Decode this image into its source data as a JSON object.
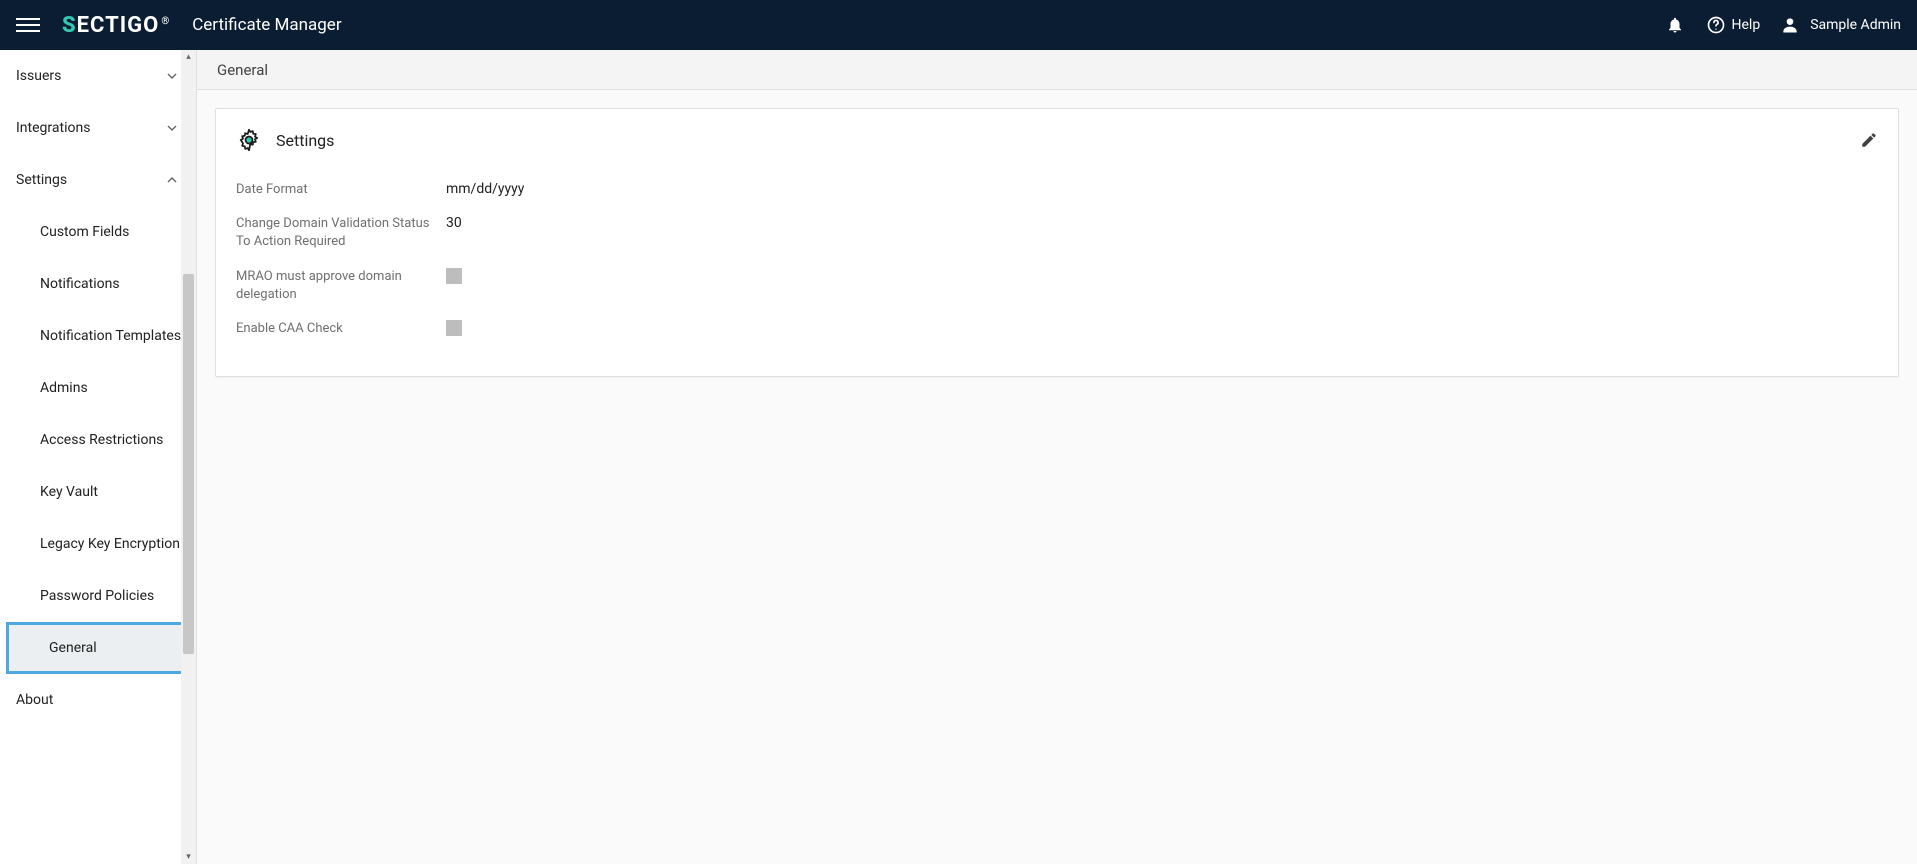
{
  "header": {
    "app_title": "Certificate Manager",
    "logo_s": "S",
    "logo_rest": "ECTIGO",
    "logo_reg": "®",
    "help_label": "Help",
    "user_name": "Sample Admin"
  },
  "sidebar": {
    "issuers": "Issuers",
    "integrations": "Integrations",
    "settings": "Settings",
    "sub": {
      "custom_fields": "Custom Fields",
      "notifications": "Notifications",
      "notification_templates": "Notification Templates",
      "admins": "Admins",
      "access_restrictions": "Access Restrictions",
      "key_vault": "Key Vault",
      "legacy_key_encryption": "Legacy Key Encryption",
      "password_policies": "Password Policies",
      "general": "General"
    },
    "about": "About"
  },
  "page": {
    "title": "General"
  },
  "card": {
    "title": "Settings",
    "rows": {
      "date_format_label": "Date Format",
      "date_format_value": "mm/dd/yyyy",
      "change_status_label": "Change Domain Validation Status To Action Required",
      "change_status_value": "30",
      "mrao_label": "MRAO must approve domain delegation",
      "caa_label": "Enable CAA Check"
    }
  }
}
